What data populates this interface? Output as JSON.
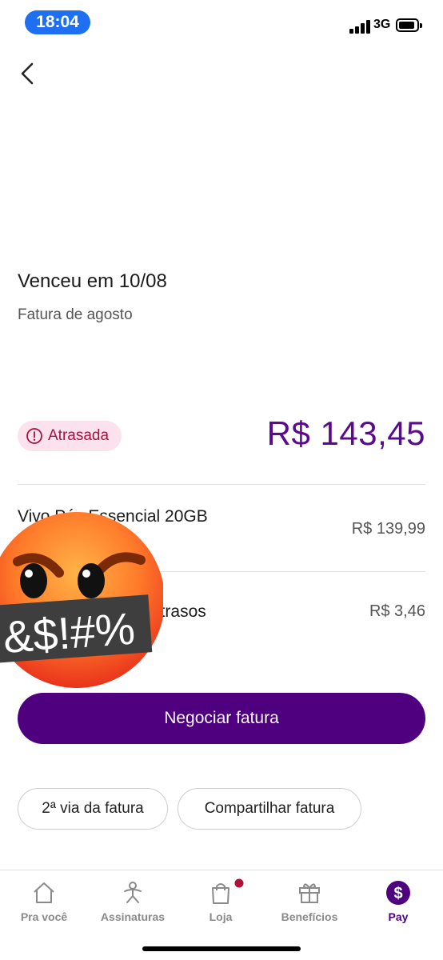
{
  "status_bar": {
    "time": "18:04",
    "network": "3G"
  },
  "invoice": {
    "due_title": "Venceu em 10/08",
    "subtitle": "Fatura de agosto",
    "status": "Atrasada",
    "total": "R$ 143,45"
  },
  "items": [
    {
      "name": "Vivo Pós Essencial 20GB",
      "value": "R$ 139,99"
    },
    {
      "name": "Juros e encargos atrasos",
      "value": "R$ 3,46"
    }
  ],
  "sticker": {
    "text": "&$!#%",
    "icon": "angry-face-emoji"
  },
  "actions": {
    "primary": "Negociar fatura",
    "secondary": [
      "2ª via da fatura",
      "Compartilhar fatura"
    ]
  },
  "bottom_nav": {
    "items": [
      {
        "label": "Pra você",
        "icon": "home-icon"
      },
      {
        "label": "Assinaturas",
        "icon": "subscriptions-icon"
      },
      {
        "label": "Loja",
        "icon": "shopping-bag-icon"
      },
      {
        "label": "Benefícios",
        "icon": "gift-icon"
      },
      {
        "label": "Pay",
        "icon": "dollar-icon"
      }
    ],
    "active": "Pay"
  },
  "colors": {
    "brand": "#4f007f",
    "amount": "#5a0a8c",
    "alert": "#a5143e",
    "alert_bg": "#fbe2ec",
    "notification_dot": "#b0103a"
  }
}
